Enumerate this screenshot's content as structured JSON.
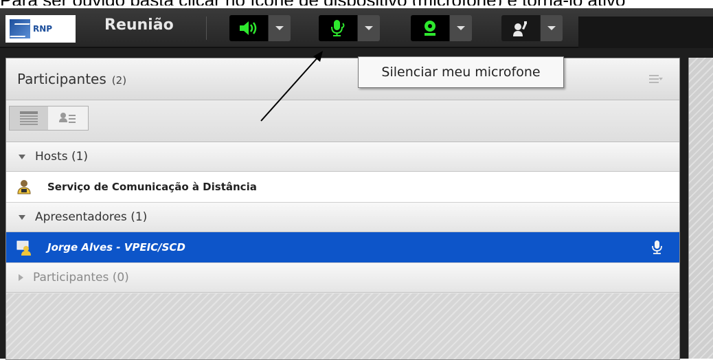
{
  "caption": {
    "text": "Para ser ouvido basta clicar no ícone de dispositivo (microfone) e torná-lo ativo"
  },
  "toolbar": {
    "logo_text": "RNP",
    "room_title": "Reunião",
    "buttons": [
      {
        "icon": "speaker-icon",
        "state": "on"
      },
      {
        "icon": "microphone-icon",
        "state": "on"
      },
      {
        "icon": "webcam-icon",
        "state": "on"
      },
      {
        "icon": "raise-hand-icon",
        "state": "neutral"
      }
    ]
  },
  "tooltip": {
    "text": "Silenciar meu microfone"
  },
  "pod": {
    "title": "Participantes",
    "count": "(2)",
    "groups": [
      {
        "label": "Hosts (1)",
        "expanded": true
      },
      {
        "label": "Apresentadores (1)",
        "expanded": true
      },
      {
        "label": "Participantes (0)",
        "expanded": false
      }
    ],
    "hosts": [
      {
        "name": "Serviço de Comunicação à Distância"
      }
    ],
    "presenters": [
      {
        "name": "Jorge Alves - VPEIC/SCD",
        "selected": true
      }
    ]
  },
  "colors": {
    "accent_green": "#2ee82e",
    "selected_row": "#0d55c9"
  }
}
